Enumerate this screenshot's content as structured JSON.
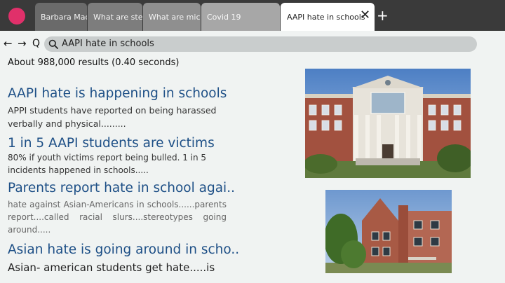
{
  "tabs": [
    {
      "label": "Barbara Mad"
    },
    {
      "label": "What are ster"
    },
    {
      "label": "What are micr..."
    },
    {
      "label": "Covid 19"
    },
    {
      "label": "AAPI hate in schools"
    }
  ],
  "tabbar": {
    "close_glyph": "✕",
    "new_tab_glyph": "+"
  },
  "nav": {
    "back_glyph": "←",
    "forward_glyph": "→",
    "reload_glyph": "Q"
  },
  "search": {
    "query": "AAPI hate in schools"
  },
  "results_stats": "About 988,000 results (0.40 seconds)",
  "results": [
    {
      "title": "AAPI hate is happening in schools",
      "snippet": "APPI students have reported on being harassed verbally and physical........."
    },
    {
      "title": "1 in 5 AAPI students are victims",
      "snippet": "80% if youth victims report being bulled. 1 in 5 incidents happened in schools....."
    },
    {
      "title": "Parents report hate in school agai..",
      "snippet": "hate against Asian-Americans in schools......parents report....called racial slurs....stereotypes going around....."
    },
    {
      "title": "Asian hate is going around in scho..",
      "snippet": "Asian- american students get hate.....is"
    }
  ],
  "icons": {
    "app": "app-logo-icon",
    "back": "back-arrow-icon",
    "forward": "forward-arrow-icon",
    "reload": "reload-icon",
    "search": "search-icon",
    "close": "close-icon",
    "new_tab": "plus-icon"
  },
  "colors": {
    "accent": "#e0306a",
    "link": "#1d4f86",
    "tabbar": "#3a3a3a",
    "page_bg": "#f0f3f2"
  }
}
